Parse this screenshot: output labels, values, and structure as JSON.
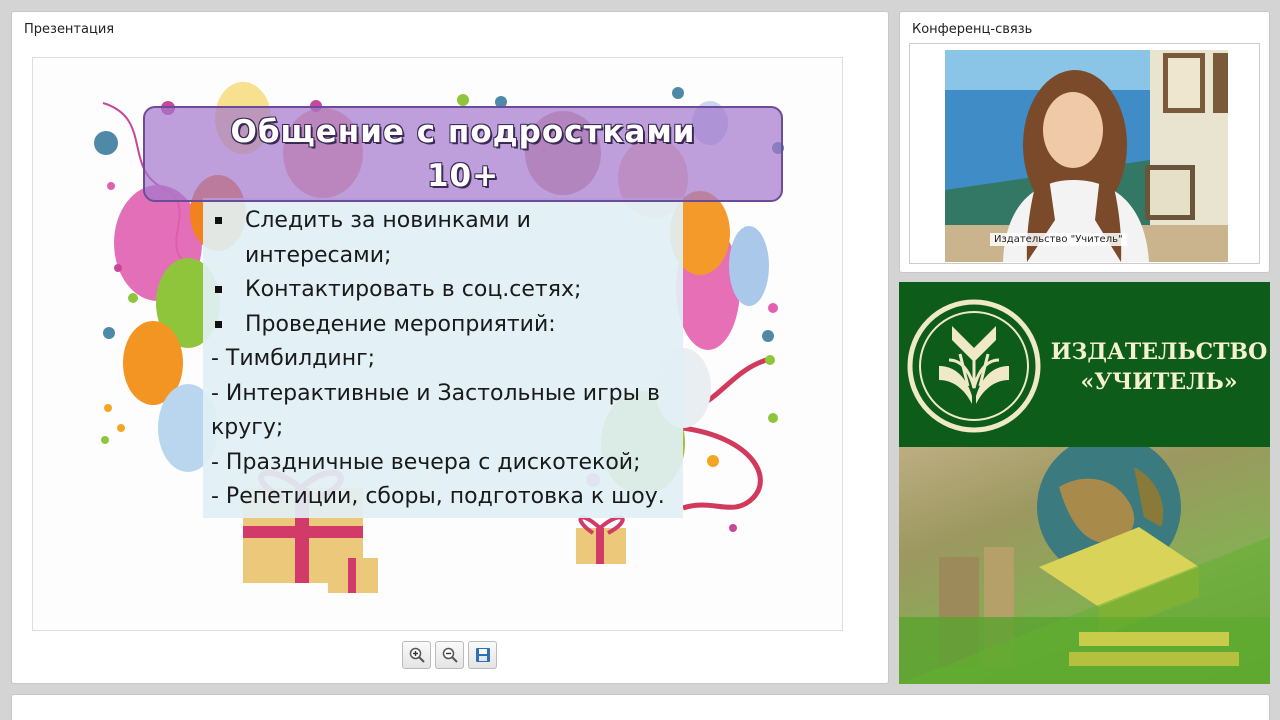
{
  "presentation": {
    "panel_title": "Презентация",
    "slide": {
      "title_line1": "Общение с подростками",
      "title_line2": "10+",
      "bullets": [
        "Следить за новинками и",
        "интересами;",
        "Контактировать в соц.сетях;",
        "Проведение мероприятий:"
      ],
      "dash_items": [
        "- Тимбилдинг;",
        "- Интерактивные и Застольные игры в",
        "кругу;",
        "- Праздничные вечера с дискотекой;",
        "- Репетиции, сборы, подготовка к шоу."
      ]
    },
    "toolbar": [
      {
        "icon": "zoom-in-icon"
      },
      {
        "icon": "zoom-out-icon"
      },
      {
        "icon": "save-icon"
      }
    ]
  },
  "conference": {
    "panel_title": "Конференц-связь",
    "participant_label": "Издательство \"Учитель\""
  },
  "publisher_banner": {
    "line1": "ИЗДАТЕЛЬСТВО",
    "line2": "«УЧИТЕЛЬ»"
  },
  "colors": {
    "title_box": "#a578cd",
    "publisher_green": "#0d5c1a",
    "logo_cream": "#f5f0d0"
  }
}
